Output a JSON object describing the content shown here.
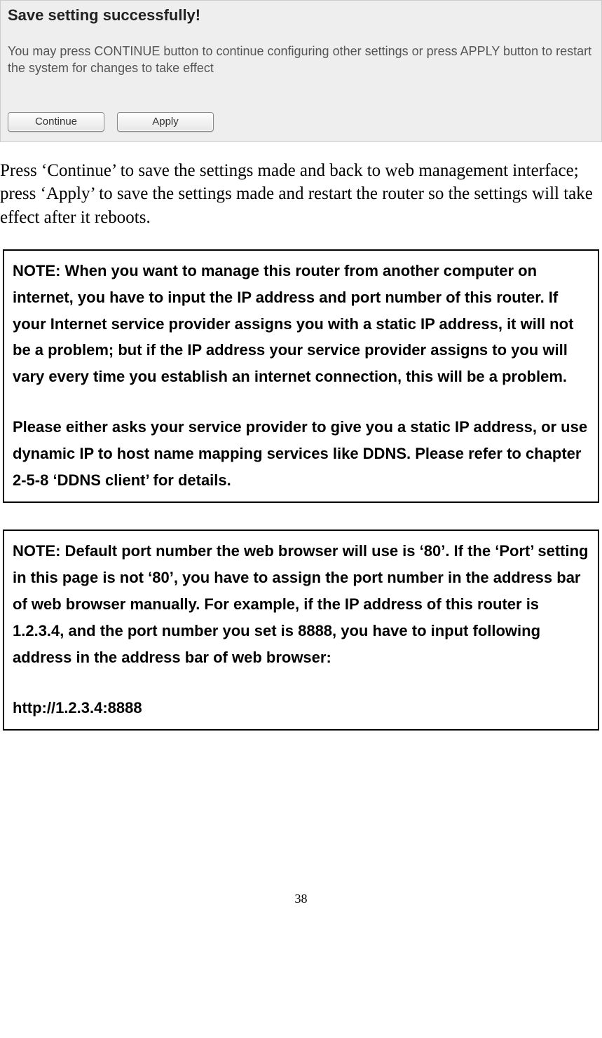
{
  "dialog": {
    "title": "Save setting successfully!",
    "message": "You may press CONTINUE button to continue configuring other settings or press APPLY button to restart the system for changes to take effect",
    "continue_label": "Continue",
    "apply_label": "Apply"
  },
  "paragraph": "Press ‘Continue’ to save the settings made and back to web management interface; press ‘Apply’ to save the settings made and restart the router so the settings will take effect after it reboots.",
  "note1": {
    "p1": "NOTE: When you want to manage this router from another computer on internet, you have to input the IP address and port number of this router. If your Internet service provider assigns you with a static IP address, it will not be a problem; but if the IP address your service provider assigns to you will vary every time you establish an internet connection, this will be a problem.",
    "p2": "Please either asks your service provider to give you a static IP address, or use dynamic IP to host name mapping services like DDNS. Please refer to chapter 2-5-8 ‘DDNS client’ for details."
  },
  "note2": {
    "p1": "NOTE: Default port number the web browser will use is ‘80’. If the ‘Port’ setting in this page is not ‘80’, you have to assign the port number in the address bar of web browser manually. For example, if the IP address of this router is 1.2.3.4, and the port number you set is 8888, you have to input following address in the address bar of web browser:",
    "p2": "http://1.2.3.4:8888"
  },
  "page_number": "38"
}
